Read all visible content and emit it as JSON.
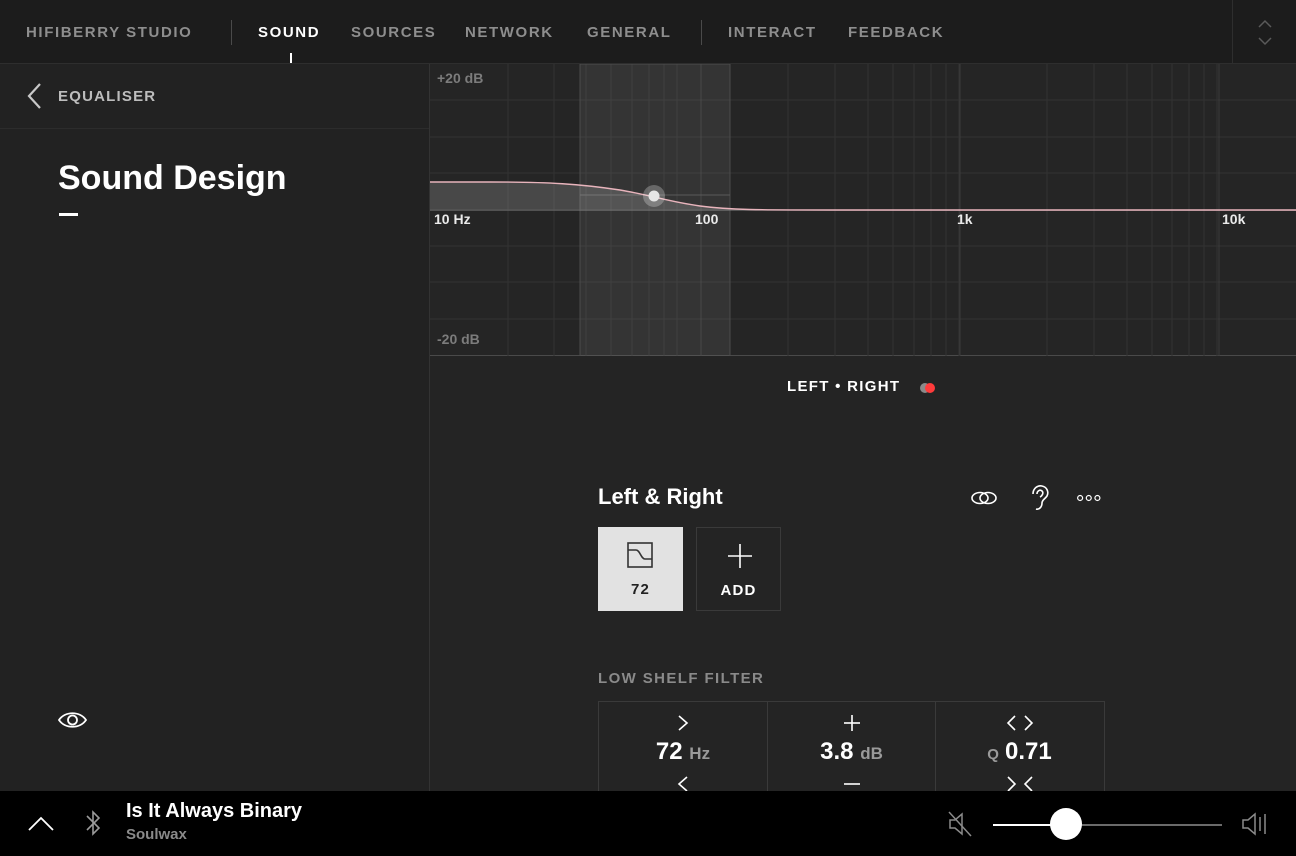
{
  "brand": "HIFIBERRY STUDIO",
  "nav": {
    "main": [
      "SOUND",
      "SOURCES",
      "NETWORK",
      "GENERAL"
    ],
    "extra": [
      "INTERACT",
      "FEEDBACK"
    ],
    "active": "SOUND"
  },
  "sidebar": {
    "back_label": "EQUALISER",
    "title": "Sound Design",
    "view_icon": "eye-icon"
  },
  "graph": {
    "db_max_label": "+20 dB",
    "db_min_label": "-20 dB",
    "freq_labels": [
      "10 Hz",
      "100",
      "1k",
      "10k"
    ],
    "curve_color": "#e8b4bc"
  },
  "channel": {
    "mode_label": "LEFT • RIGHT",
    "mode_colors": [
      "#8a8a8a",
      "#ff3b3b"
    ],
    "title": "Left & Right",
    "icons": [
      "link-icon",
      "ear-icon",
      "more-icon"
    ],
    "filters": [
      {
        "label": "72",
        "icon": "low-shelf-icon",
        "selected": true
      }
    ],
    "add_label": "ADD"
  },
  "filter": {
    "type_label": "LOW SHELF FILTER",
    "frequency": {
      "value": "72",
      "unit": "Hz"
    },
    "gain": {
      "value": "3.8",
      "unit": "dB"
    },
    "q": {
      "prefix": "Q",
      "value": "0.71"
    }
  },
  "player": {
    "title": "Is It Always Binary",
    "artist": "Soulwax",
    "volume": 0.32,
    "icons": [
      "chevron-up-icon",
      "bluetooth-icon",
      "mute-icon",
      "volume-max-icon"
    ]
  }
}
